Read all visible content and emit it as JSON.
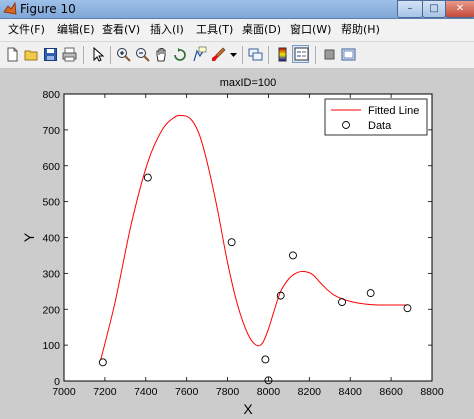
{
  "window": {
    "title": "Figure 10",
    "controls": {
      "minimize": "–",
      "maximize": "□",
      "close": "✕"
    }
  },
  "menu": [
    "文件(F)",
    "编辑(E)",
    "查看(V)",
    "插入(I)",
    "工具(T)",
    "桌面(D)",
    "窗口(W)",
    "帮助(H)"
  ],
  "toolbar": {
    "buttons": [
      "new-file-icon",
      "open-folder-icon",
      "save-icon",
      "print-icon",
      "pointer-icon",
      "zoom-in-icon",
      "zoom-out-icon",
      "pan-hand-icon",
      "rotate-3d-icon",
      "data-cursor-icon",
      "brush-icon",
      "dropdown-arrow-icon",
      "link-plot-icon",
      "colorbar-icon",
      "legend-icon",
      "hide-plot-tools-icon",
      "show-plot-tools-icon"
    ],
    "pressed": "legend-icon"
  },
  "chart_data": {
    "type": "line",
    "title": "maxID=100",
    "xlabel": "X",
    "ylabel": "Y",
    "xlim": [
      7000,
      8800
    ],
    "ylim": [
      0,
      800
    ],
    "xticks": [
      7000,
      7200,
      7400,
      7600,
      7800,
      8000,
      8200,
      8400,
      8600,
      8800
    ],
    "yticks": [
      0,
      100,
      200,
      300,
      400,
      500,
      600,
      700,
      800
    ],
    "grid": false,
    "legend_position": "top-right",
    "series": [
      {
        "name": "Fitted Line",
        "style": "line",
        "color": "#ff0000",
        "x": [
          7180,
          7250,
          7330,
          7410,
          7480,
          7540,
          7580,
          7620,
          7660,
          7700,
          7750,
          7800,
          7850,
          7900,
          7940,
          7970,
          8000,
          8030,
          8060,
          8100,
          8140,
          8180,
          8220,
          8260,
          8320,
          8400,
          8500,
          8600,
          8680
        ],
        "y": [
          60,
          220,
          440,
          610,
          700,
          735,
          740,
          730,
          690,
          610,
          480,
          330,
          210,
          130,
          100,
          105,
          145,
          200,
          250,
          285,
          302,
          305,
          295,
          270,
          240,
          222,
          213,
          212,
          212
        ]
      },
      {
        "name": "Data",
        "style": "marker",
        "marker": "circle",
        "color": "#000000",
        "x": [
          7190,
          7410,
          7820,
          7985,
          8000,
          8060,
          8120,
          8360,
          8500,
          8680
        ],
        "y": [
          52,
          567,
          387,
          60,
          2,
          238,
          350,
          220,
          245,
          203
        ]
      }
    ]
  }
}
